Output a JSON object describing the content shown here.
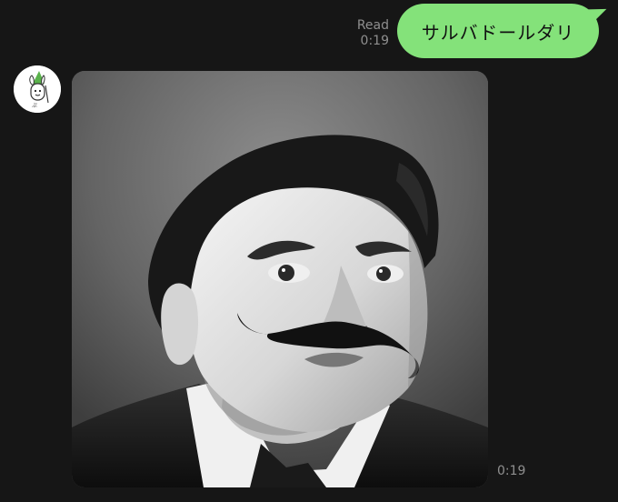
{
  "outgoing": {
    "read_label": "Read",
    "time": "0:19",
    "text": "サルバドールダリ",
    "bubble_color": "#84e27a"
  },
  "incoming": {
    "time": "0:19",
    "avatar_icon": "rabbit-wizard-icon",
    "image_icon": "portrait-image"
  },
  "colors": {
    "background": "#161616",
    "meta_text": "#8f8f8f"
  }
}
